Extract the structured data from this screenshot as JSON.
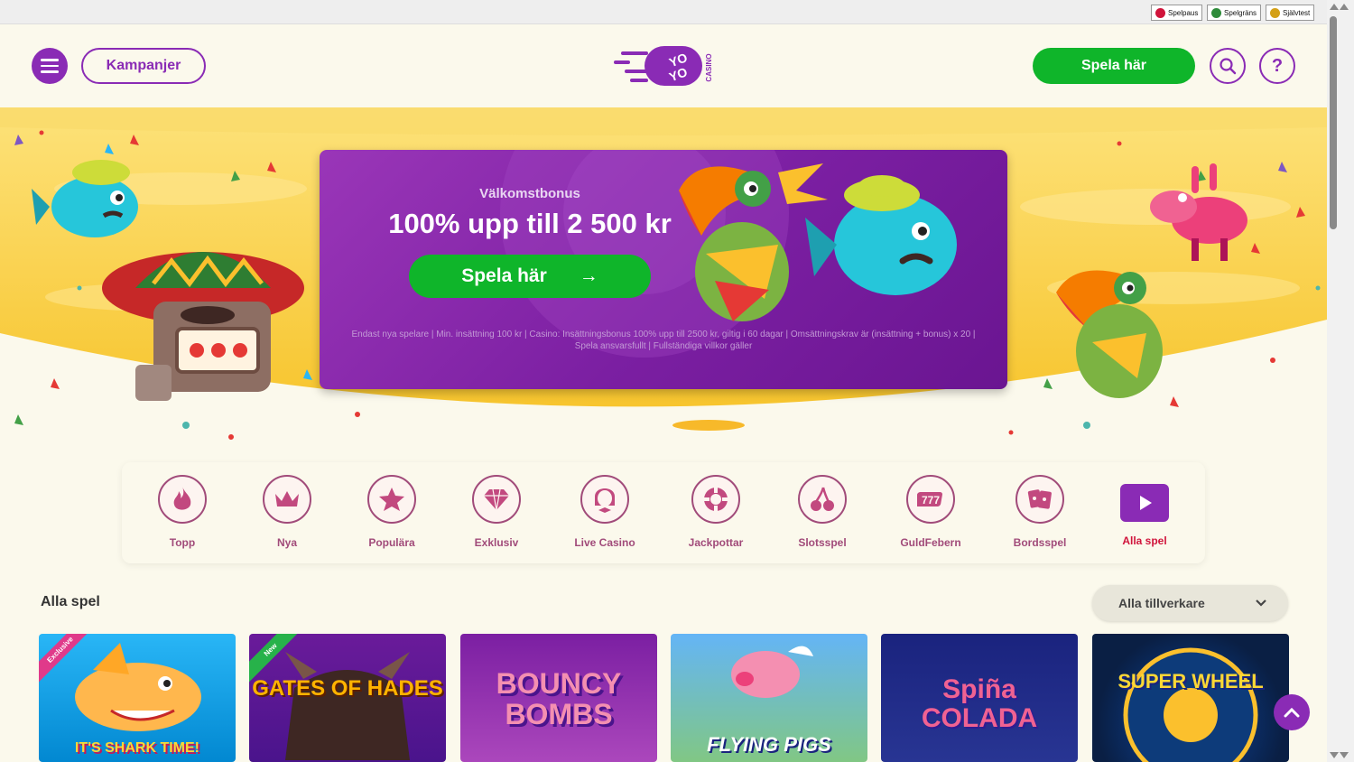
{
  "responsible_gaming": [
    {
      "label": "Spelpaus",
      "icon": "spelpaus-icon",
      "color": "#d0143b"
    },
    {
      "label": "Spelgräns",
      "icon": "spelgrans-icon",
      "color": "#2e8b3a"
    },
    {
      "label": "Självtest",
      "icon": "sjalvtest-icon",
      "color": "#d4a017"
    }
  ],
  "header": {
    "kampanjer_label": "Kampanjer",
    "logo_text_top": "YO",
    "logo_text_bottom": "YO",
    "logo_casino": "CASINO",
    "spela_label": "Spela här",
    "help_symbol": "?"
  },
  "promo": {
    "subtitle": "Välkomstbonus",
    "title": "100% upp till 2 500 kr",
    "cta_label": "Spela här",
    "cta_arrow": "→",
    "terms": "Endast nya spelare | Min. insättning 100 kr | Casino: Insättningsbonus 100% upp till 2500 kr, giltig i 60 dagar | Omsättningskrav är (insättning + bonus) x 20 | Spela ansvarsfullt | Fullständiga villkor gäller"
  },
  "categories": [
    {
      "label": "Topp",
      "icon": "flame-icon"
    },
    {
      "label": "Nya",
      "icon": "crown-icon"
    },
    {
      "label": "Populära",
      "icon": "star-icon"
    },
    {
      "label": "Exklusiv",
      "icon": "diamond-icon"
    },
    {
      "label": "Live Casino",
      "icon": "dealer-icon"
    },
    {
      "label": "Jackpottar",
      "icon": "jackpot-icon"
    },
    {
      "label": "Slotsspel",
      "icon": "cherry-icon"
    },
    {
      "label": "GuldFebern",
      "icon": "seven-icon"
    },
    {
      "label": "Bordsspel",
      "icon": "cards-icon"
    },
    {
      "label": "Alla spel",
      "icon": "play-icon"
    }
  ],
  "games_section": {
    "title": "Alla spel",
    "provider_label": "Alla tillverkare"
  },
  "games": [
    {
      "title": "IT'S SHARK TIME!",
      "badge": "Exclusive"
    },
    {
      "title": "GATES OF HADES",
      "badge": "New"
    },
    {
      "title": "BOUNCY BOMBS",
      "badge": ""
    },
    {
      "title": "FLYING PIGS",
      "badge": ""
    },
    {
      "title": "Spiña COLADA",
      "badge": ""
    },
    {
      "title": "SUPER WHEEL",
      "badge": ""
    }
  ],
  "colors": {
    "brand_purple": "#8a2bb5",
    "cta_green": "#0fb52a",
    "hero_yellow": "#f8cd3e",
    "background": "#fbf9ec"
  }
}
